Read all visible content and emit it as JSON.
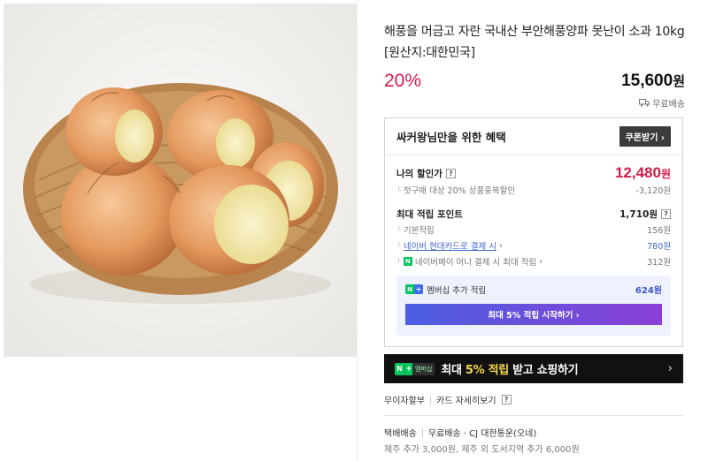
{
  "product": {
    "title": "해풍을 머금고 자란 국내산 부안해풍양파 못난이 소과 10kg [원산지:대한민국]",
    "discount": "20%",
    "price": "15,600",
    "won": "원",
    "shipping_label": "무료배송"
  },
  "benefit": {
    "title": "싸커왕님만을 위한 혜택",
    "coupon_button": "쿠폰받기 ›",
    "my_price_label": "나의 할인가",
    "my_price": "12,480",
    "my_price_won": "원",
    "first_purchase_note": "첫구매 대상 20% 상품중복할인",
    "first_purchase_amount": "-3,120원",
    "max_points_label": "최대 적립 포인트",
    "max_points": "1,710원",
    "basic_label": "기본적립",
    "basic_value": "156원",
    "card_label": "네이버 현대카드로 결제 시",
    "card_value": "780원",
    "npay_label": "네이버페이 머니 결제 시 최대 적립",
    "npay_value": "312원",
    "membership_label": "멤버십 추가 적립",
    "membership_value": "624원",
    "start_button": "최대 5% 적립 시작하기 ›"
  },
  "banner": {
    "badge_text": "멤버십",
    "text_before": "최대 ",
    "highlight": "5% 적립",
    "text_after": " 받고 쇼핑하기",
    "chevron": "›"
  },
  "payment": {
    "installment": "무이자할부",
    "card_detail": "카드 자세히보기"
  },
  "delivery": {
    "method": "택배배송",
    "fee": "무료배송 · CJ 대한통운(오네)",
    "extra": "제주 추가 3,000원, 제주 외 도서지역 추가 6,000원"
  },
  "colors": {
    "accent": "#d81b4a",
    "link": "#4266cf",
    "naver_green": "#03c75a"
  }
}
